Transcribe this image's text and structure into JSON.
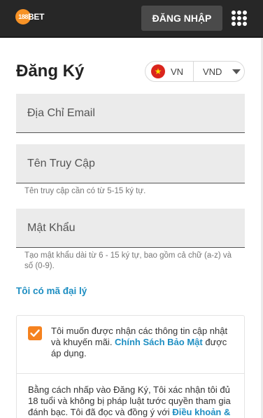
{
  "header": {
    "logo_number": "188",
    "logo_text": "BET",
    "login_label": "ĐĂNG NHẬP",
    "menu_icon": "grid-menu-icon"
  },
  "page": {
    "title": "Đăng Ký"
  },
  "locale": {
    "flag_icon": "vietnam-flag-icon",
    "language": "VN",
    "currency": "VND"
  },
  "form": {
    "email_placeholder": "Địa Chỉ Email",
    "username_placeholder": "Tên Truy Cập",
    "username_hint": "Tên truy cập cần có từ 5-15 ký tự.",
    "password_placeholder": "Mật Khẩu",
    "password_hint": "Tạo mật khẩu dài từ 6 - 15 ký tự, bao gồm cả chữ (a-z) và số (0-9).",
    "agent_link": "Tôi có mã đại lý"
  },
  "consent": {
    "checked": true,
    "text_before": "Tôi muốn được nhận các thông tin cập nhật và khuyến mãi. ",
    "privacy_link": "Chính Sách Bảo Mật",
    "text_after": " được áp dụng."
  },
  "terms": {
    "text": "Bằng cách nhấp vào Đăng Ký, Tôi xác nhận tôi đủ 18 tuổi và không bị pháp luật tước quyền tham gia đánh bạc. Tôi đã đọc và đồng ý với ",
    "link": "Điều khoản & Điều"
  },
  "colors": {
    "topbar": "#272727",
    "accent_orange": "#f5821f",
    "link_blue": "#1d8ec2",
    "field_bg": "#ebebeb"
  }
}
